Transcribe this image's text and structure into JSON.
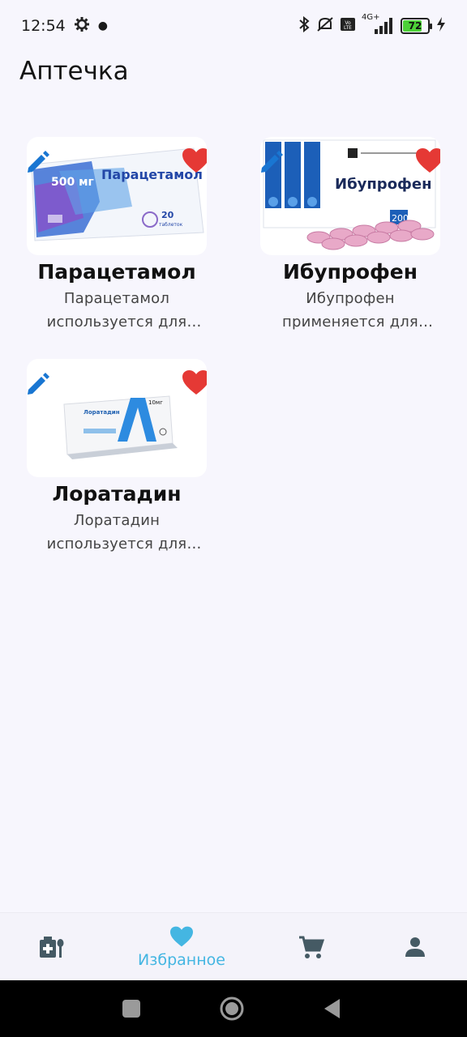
{
  "status_bar": {
    "time": "12:54",
    "battery": "72",
    "network": "4G+",
    "icons": [
      "gear-icon",
      "bluetooth-icon",
      "mute-icon",
      "volte-icon",
      "signal-icon",
      "battery-icon",
      "charging-icon"
    ]
  },
  "page": {
    "title": "Аптечка"
  },
  "medicines": [
    {
      "name": "Парацетамол",
      "description": "Парацетамол используется для снижения температуры и облегчения боли",
      "box": {
        "text": "Парацетамол",
        "dose": "500 мг",
        "count": "20",
        "count_unit": "таблеток"
      }
    },
    {
      "name": "Ибупрофен",
      "description": "Ибупрофен применяется для лечения воспаления и боли",
      "box": {
        "text": "Ибупрофен",
        "dose": "200"
      }
    },
    {
      "name": "Лоратадин",
      "description": "Лоратадин используется для облегчения симптомов аллергии",
      "box": {
        "text": "Лоратадин",
        "dose": "10мг"
      }
    }
  ],
  "bottom_nav": {
    "items": [
      {
        "icon": "medkit-icon",
        "label": ""
      },
      {
        "icon": "heart-icon",
        "label": "Избранное"
      },
      {
        "icon": "cart-icon",
        "label": ""
      },
      {
        "icon": "person-icon",
        "label": ""
      }
    ],
    "active_index": 1
  },
  "colors": {
    "accent": "#44b6e2",
    "heart": "#e53935",
    "edit": "#1976d2",
    "background": "#f7f6fd"
  }
}
